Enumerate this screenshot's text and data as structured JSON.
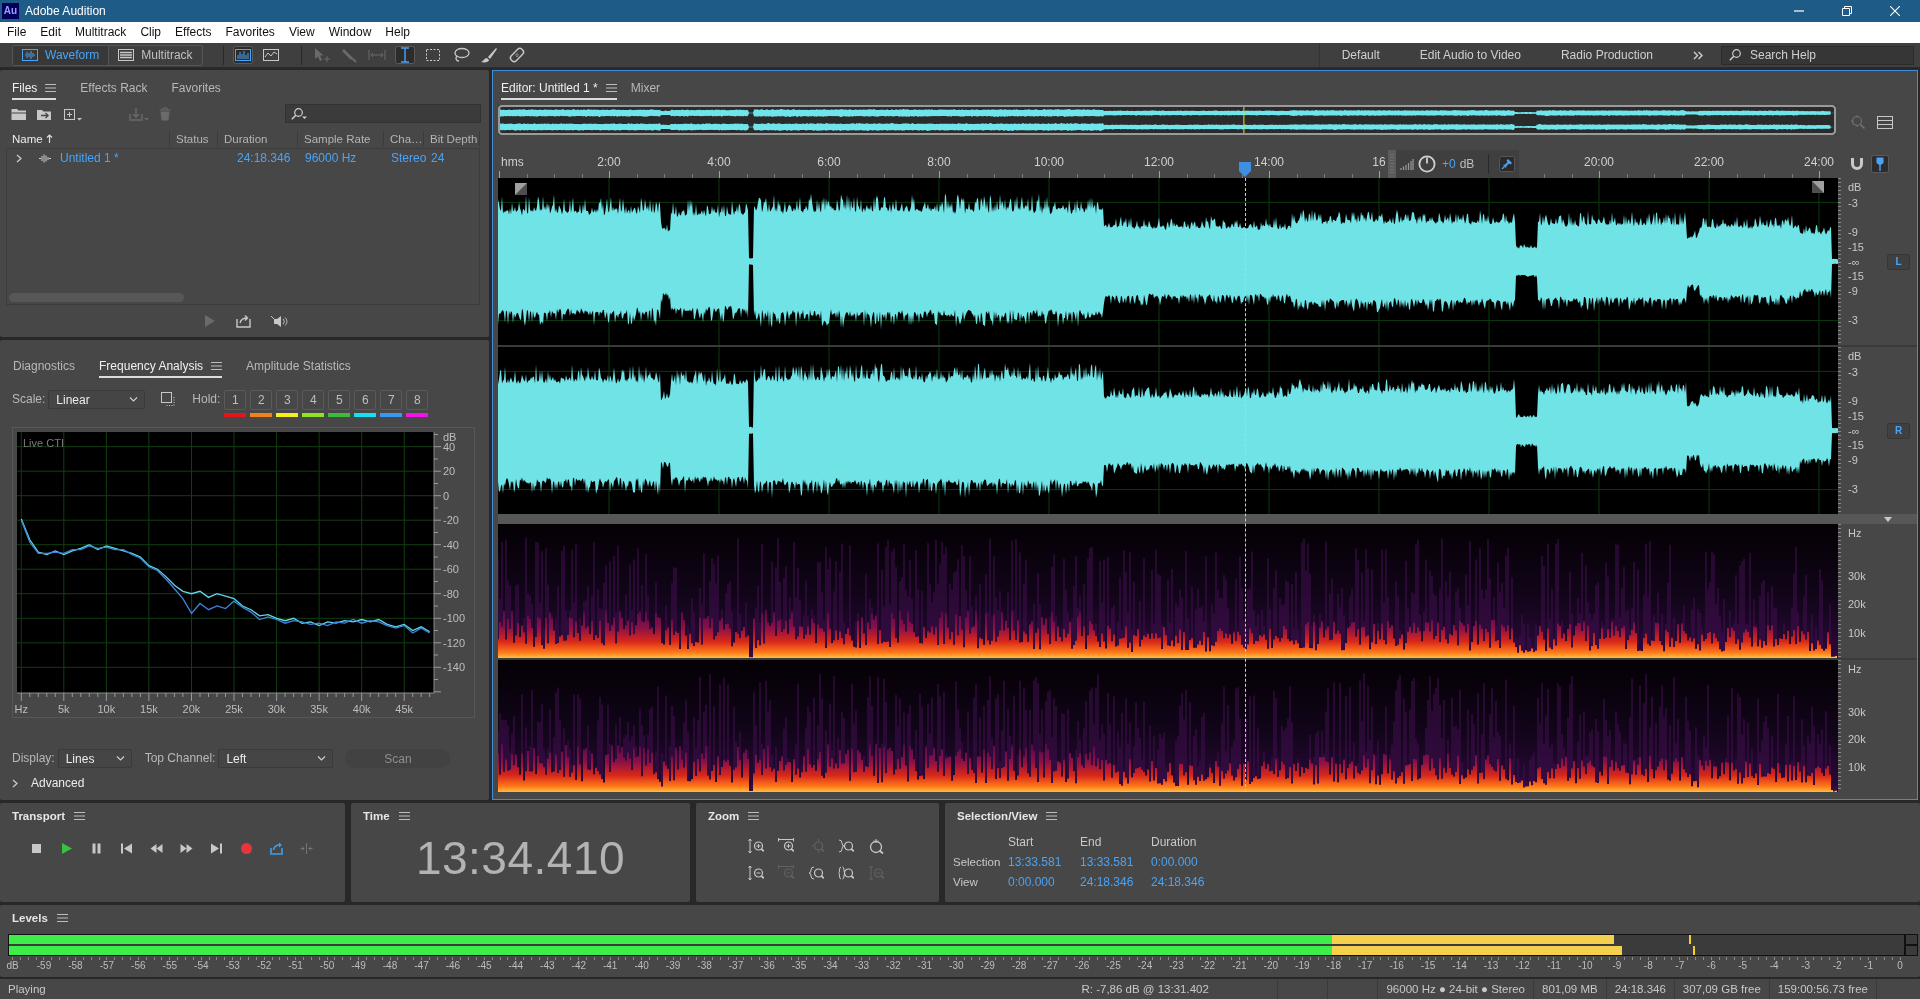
{
  "window": {
    "logo": "Au",
    "title": "Adobe Audition"
  },
  "menu": [
    "File",
    "Edit",
    "Multitrack",
    "Clip",
    "Effects",
    "Favorites",
    "View",
    "Window",
    "Help"
  ],
  "toolbar": {
    "modes": [
      {
        "kind": "waveform",
        "label": "Waveform",
        "selected": true
      },
      {
        "kind": "multitrack",
        "label": "Multitrack",
        "selected": false
      }
    ],
    "views": [
      {
        "kind": "spectral-frequency",
        "selected": true
      },
      {
        "kind": "spectral-pitch",
        "selected": false
      }
    ],
    "tools": [
      {
        "kind": "move",
        "selected": false,
        "disabled": true
      },
      {
        "kind": "razor",
        "selected": false,
        "disabled": true
      },
      {
        "kind": "slip",
        "selected": false,
        "disabled": true
      },
      {
        "kind": "time-selection",
        "selected": true,
        "disabled": false
      },
      {
        "kind": "marquee",
        "selected": false,
        "disabled": false
      },
      {
        "kind": "lasso",
        "selected": false,
        "disabled": false
      },
      {
        "kind": "brush",
        "selected": false,
        "disabled": false
      },
      {
        "kind": "spot-healing",
        "selected": false,
        "disabled": false
      }
    ],
    "workspaces": [
      "Default",
      "Edit Audio to Video",
      "Radio Production"
    ],
    "search": {
      "placeholder": "Search Help"
    }
  },
  "files_panel": {
    "tabs": [
      {
        "label": "Files",
        "selected": true
      },
      {
        "label": "Effects Rack",
        "selected": false
      },
      {
        "label": "Favorites",
        "selected": false
      }
    ],
    "tools": [
      {
        "kind": "open",
        "disabled": false
      },
      {
        "kind": "import",
        "disabled": false
      },
      {
        "kind": "new",
        "disabled": false
      },
      {
        "kind": "insert",
        "disabled": true
      },
      {
        "kind": "delete",
        "disabled": true
      }
    ],
    "columns": [
      {
        "label": "Name",
        "sorted": true
      },
      {
        "label": "Status",
        "sorted": false
      },
      {
        "label": "Duration",
        "sorted": false
      },
      {
        "label": "Sample Rate",
        "sorted": false
      },
      {
        "label": "Cha…",
        "sorted": false
      },
      {
        "label": "Bit Depth",
        "sorted": false
      }
    ],
    "rows": [
      {
        "expanded": false,
        "name": "Untitled 1 *",
        "duration": "24:18.346",
        "sample_rate": "96000 Hz",
        "channels": "Stereo",
        "bit_depth": "24"
      }
    ],
    "preview": [
      {
        "kind": "play",
        "disabled": true
      },
      {
        "kind": "export",
        "disabled": false
      },
      {
        "kind": "autoplay",
        "disabled": false
      }
    ]
  },
  "analysis_panel": {
    "tabs": [
      {
        "label": "Diagnostics",
        "selected": false
      },
      {
        "label": "Frequency Analysis",
        "selected": true
      },
      {
        "label": "Amplitude Statistics",
        "selected": false
      }
    ],
    "scale": {
      "label": "Scale:",
      "value": "Linear"
    },
    "hold": {
      "label": "Hold:",
      "buttons": [
        {
          "label": "1",
          "color": "#e8141c"
        },
        {
          "label": "2",
          "color": "#f0821e"
        },
        {
          "label": "3",
          "color": "#f5ee1e"
        },
        {
          "label": "4",
          "color": "#8ee41e"
        },
        {
          "label": "5",
          "color": "#3cbc3c"
        },
        {
          "label": "6",
          "color": "#14e1f0"
        },
        {
          "label": "7",
          "color": "#3c96f0"
        },
        {
          "label": "8",
          "color": "#f014e6"
        }
      ]
    },
    "chart_data": {
      "type": "line",
      "xlabel": "Hz",
      "ylabel": "dB",
      "x": [
        0,
        1000,
        2000,
        3000,
        4000,
        5000,
        6000,
        7000,
        8000,
        9000,
        10000,
        11000,
        12000,
        13000,
        14000,
        15000,
        16000,
        17000,
        18000,
        19000,
        20000,
        21000,
        22000,
        23000,
        24000,
        25000,
        26000,
        27000,
        28000,
        29000,
        30000,
        31000,
        32000,
        33000,
        34000,
        35000,
        36000,
        37000,
        38000,
        39000,
        40000,
        41000,
        42000,
        43000,
        44000,
        45000,
        46000,
        47000,
        48000
      ],
      "series": [
        {
          "color": "#5fd8e8",
          "values": [
            -19,
            -36,
            -46,
            -48,
            -45,
            -48,
            -45,
            -43,
            -40,
            -44,
            -41,
            -43,
            -45,
            -47,
            -50,
            -57,
            -60,
            -66,
            -73,
            -78,
            -80,
            -78,
            -83,
            -80,
            -82,
            -84,
            -90,
            -93,
            -98,
            -97,
            -100,
            -102,
            -100,
            -104,
            -103,
            -106,
            -103,
            -104,
            -102,
            -103,
            -101,
            -103,
            -101,
            -105,
            -107,
            -105,
            -110,
            -107,
            -111
          ]
        },
        {
          "color": "#3f84dc",
          "values": [
            -20,
            -38,
            -47,
            -47,
            -46,
            -47,
            -44,
            -44,
            -41,
            -43,
            -42,
            -44,
            -44,
            -48,
            -51,
            -58,
            -61,
            -68,
            -76,
            -84,
            -96,
            -88,
            -93,
            -90,
            -92,
            -86,
            -91,
            -95,
            -101,
            -99,
            -101,
            -104,
            -102,
            -103,
            -105,
            -104,
            -106,
            -103,
            -104,
            -101,
            -104,
            -102,
            -103,
            -106,
            -108,
            -106,
            -112,
            -108,
            -112
          ]
        }
      ],
      "xlim": [
        -500,
        48500
      ],
      "ylim": [
        -161,
        52
      ],
      "xticks": [
        {
          "value": 5000,
          "label": "5k"
        },
        {
          "value": 10000,
          "label": "10k"
        },
        {
          "value": 15000,
          "label": "15k"
        },
        {
          "value": 20000,
          "label": "20k"
        },
        {
          "value": 25000,
          "label": "25k"
        },
        {
          "value": 30000,
          "label": "30k"
        },
        {
          "value": 35000,
          "label": "35k"
        },
        {
          "value": 40000,
          "label": "40k"
        },
        {
          "value": 45000,
          "label": "45k"
        }
      ],
      "yticks": [
        40,
        20,
        0,
        -20,
        -40,
        -60,
        -80,
        -100,
        -120,
        -140
      ],
      "grid": true,
      "annotations": [
        "Live CTI"
      ]
    },
    "display": {
      "label": "Display:",
      "value": "Lines"
    },
    "top_channel": {
      "label": "Top Channel:",
      "value": "Left"
    },
    "scan_button": {
      "label": "Scan",
      "disabled": true
    },
    "advanced": {
      "label": "Advanced",
      "expanded": false
    }
  },
  "editor": {
    "tabs": [
      {
        "label": "Editor: Untitled 1 *",
        "selected": true
      },
      {
        "label": "Mixer",
        "selected": false
      }
    ],
    "ruler": {
      "unit": "hms",
      "labels": [
        "2:00",
        "4:00",
        "6:00",
        "8:00",
        "10:00",
        "12:00",
        "14:00",
        "16"
      ],
      "labels_after_hud": [
        "20:00",
        "22:00",
        "24:00"
      ]
    },
    "hud": {
      "value": "+0",
      "unit": "dB",
      "pinned": true
    },
    "ruler_tools": [
      {
        "kind": "snap",
        "on": false
      },
      {
        "kind": "marker",
        "on": true
      }
    ],
    "playhead": {
      "level": 0.5575
    },
    "channels": [
      {
        "label": "L",
        "on": true,
        "scale": [
          "dB",
          "-3",
          "-9",
          "-15",
          "-∞",
          "-15",
          "-9",
          "-3"
        ]
      },
      {
        "label": "R",
        "on": true,
        "scale": [
          "dB",
          "-3",
          "-9",
          "-15",
          "-∞",
          "-15",
          "-9",
          "-3"
        ]
      }
    ],
    "spectral_channels": [
      {
        "scale": [
          "Hz",
          "30k",
          "20k",
          "10k"
        ]
      },
      {
        "scale": [
          "Hz",
          "30k",
          "20k",
          "10k"
        ]
      }
    ]
  },
  "transport": {
    "title": "Transport",
    "buttons": [
      {
        "kind": "stop",
        "on": false,
        "disabled": false
      },
      {
        "kind": "play",
        "on": false,
        "disabled": false
      },
      {
        "kind": "pause",
        "on": false,
        "disabled": false
      },
      {
        "kind": "go-to-start",
        "on": false,
        "disabled": false
      },
      {
        "kind": "rewind",
        "on": false,
        "disabled": false
      },
      {
        "kind": "fast-forward",
        "on": false,
        "disabled": false
      },
      {
        "kind": "go-to-end",
        "on": false,
        "disabled": false
      },
      {
        "kind": "record",
        "on": false,
        "disabled": false
      },
      {
        "kind": "loop",
        "on": true,
        "disabled": false
      },
      {
        "kind": "skip-selection",
        "on": false,
        "disabled": true
      }
    ]
  },
  "time": {
    "title": "Time",
    "value": "13:34.410"
  },
  "zoom": {
    "title": "Zoom",
    "buttons": [
      {
        "kind": "in-amplitude",
        "disabled": false
      },
      {
        "kind": "in-time",
        "disabled": false
      },
      {
        "kind": "to-selection",
        "disabled": true
      },
      {
        "kind": "in-point",
        "disabled": false
      },
      {
        "kind": "full",
        "disabled": false
      },
      {
        "kind": "out-amplitude",
        "disabled": false
      },
      {
        "kind": "out-time",
        "disabled": true
      },
      {
        "kind": "out-point",
        "disabled": false
      },
      {
        "kind": "in-out-points",
        "disabled": false
      },
      {
        "kind": "selected-track",
        "disabled": true
      }
    ]
  },
  "selection_view": {
    "title": "Selection/View",
    "columns": [
      "Start",
      "End",
      "Duration"
    ],
    "rows": [
      {
        "label": "Selection",
        "values": [
          "13:33.581",
          "13:33.581",
          "0:00.000"
        ]
      },
      {
        "label": "View",
        "values": [
          "0:00.000",
          "24:18.346",
          "24:18.346"
        ]
      }
    ]
  },
  "levels": {
    "title": "Levels",
    "channels": [
      {
        "level": 0.847,
        "peak": {
          "level": 0.8866
        }
      },
      {
        "level": 0.851,
        "peak": {
          "level": 0.8887
        }
      }
    ],
    "scale": [
      "dB",
      "-59",
      "-58",
      "-57",
      "-56",
      "-55",
      "-54",
      "-53",
      "-52",
      "-51",
      "-50",
      "-49",
      "-48",
      "-47",
      "-46",
      "-45",
      "-44",
      "-43",
      "-42",
      "-41",
      "-40",
      "-39",
      "-38",
      "-37",
      "-36",
      "-35",
      "-34",
      "-33",
      "-32",
      "-31",
      "-30",
      "-29",
      "-28",
      "-27",
      "-26",
      "-25",
      "-24",
      "-23",
      "-22",
      "-21",
      "-20",
      "-19",
      "-18",
      "-17",
      "-16",
      "-15",
      "-14",
      "-13",
      "-12",
      "-11",
      "-10",
      "-9",
      "-8",
      "-7",
      "-6",
      "-5",
      "-4",
      "-3",
      "-2",
      "-1",
      "0"
    ]
  },
  "status_bar": {
    "state": "Playing",
    "items": [
      "R: -7,86 dB @ 13:31.402",
      "96000 Hz ● 24-bit ● Stereo",
      "801,09 MB",
      "24:18.346",
      "307,09 GB free",
      "159:00:56.73 free"
    ]
  }
}
